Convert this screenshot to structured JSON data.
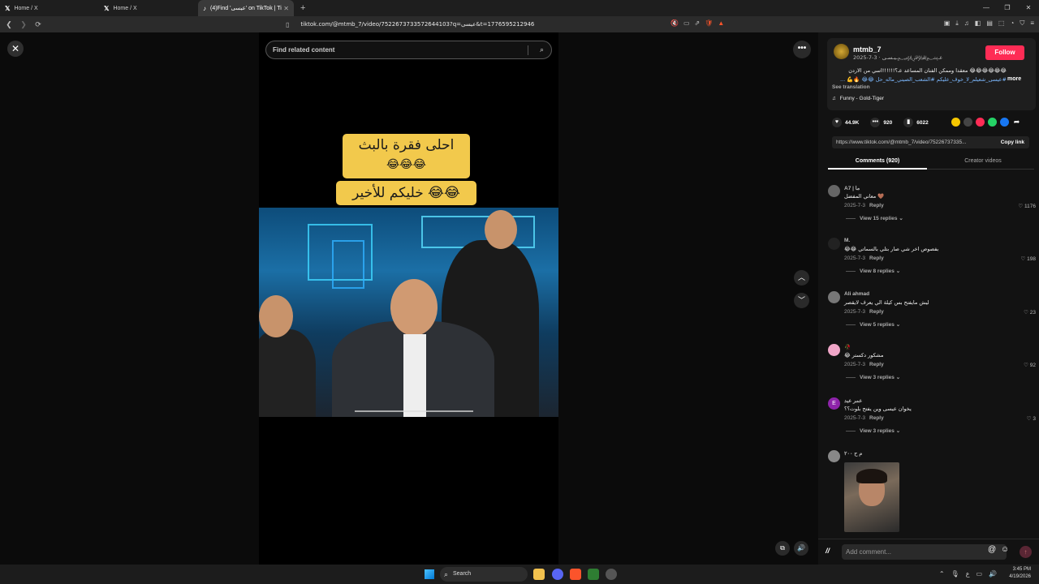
{
  "browser": {
    "tabs": [
      {
        "label": "Home / X",
        "icon": "x-logo"
      },
      {
        "label": "Home / X",
        "icon": "x-logo"
      },
      {
        "label": "(4)Find 'عيسى' on TikTok | Tik",
        "icon": "tiktok-logo"
      }
    ],
    "url": "tiktok.com/@mtmb_7/video/7522673733572644103?q=عيسى&t=1776595212946"
  },
  "player": {
    "search_placeholder": "Find related content",
    "caption_line1": "احلى فقرة بالبث",
    "caption_line2": "😂😂😂",
    "caption_line3": "خليكم للأخير 😂😂"
  },
  "author": {
    "name": "mtmb_7",
    "subtitle": "2025-7-3 · عـ﷽ـيـسـى",
    "follow_label": "Follow",
    "description": "😂😂😂😂😂😂 معقدا وممكن الفنان المساعد عـ؟!!!!!!اسي من الاردن",
    "hashtags": "#عيسى_شعيلم_لا_خوف_عليكم #الشعب_الصيني_ماله_حل 😂😂 🔥💪 ...",
    "more_label": "more",
    "see_translation": "See translation",
    "music": "Funny - Gold-Tiger"
  },
  "stats": {
    "likes": "44.9K",
    "comments": "920",
    "saves": "6022"
  },
  "share": {
    "link": "https://www.tiktok.com/@mtmb_7/video/75226737335...",
    "copy_label": "Copy link"
  },
  "panel_tabs": {
    "comments": "Comments (920)",
    "creator": "Creator videos"
  },
  "comments": [
    {
      "name": "A7 | ما",
      "text": "معاني المفضل 🤎",
      "date": "2025-7-3",
      "likes": "1176",
      "replies": "View 15 replies"
    },
    {
      "name": "M.",
      "text": "😂😂 بفصوص اخر شي صار بتلي بالسماتي",
      "date": "2025-7-3",
      "likes": "198",
      "replies": "View 8 replies"
    },
    {
      "name": "Ali ahmad",
      "text": "ليش مايفتح بس كيلة الي يعرف لايقصر",
      "date": "2025-7-3",
      "likes": "23",
      "replies": "View 5 replies"
    },
    {
      "name": "🥀",
      "text": "😂 مشكور دكستر",
      "date": "2025-7-3",
      "likes": "92",
      "replies": "View 3 replies"
    },
    {
      "name": "عمر عبد",
      "text": "يخوان عيسى وين يفتح بلوت؟؟",
      "date": "2025-7-3",
      "likes": "3",
      "replies": "View 3 replies"
    },
    {
      "name": "م ح ٢٠٠",
      "text": "",
      "date": "",
      "likes": "",
      "replies": ""
    }
  ],
  "reply_label": "Reply",
  "comment_input_placeholder": "Add comment...",
  "taskbar": {
    "search": "Search",
    "time": "3:45 PM",
    "date": "4/19/2026"
  },
  "colors": {
    "accent": "#fe2c55",
    "caption_bg": "#f2c94c"
  }
}
